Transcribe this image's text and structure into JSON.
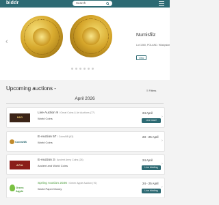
{
  "header": {
    "logo": "biddr",
    "search_placeholder": "Search"
  },
  "hero": {
    "title": "Numisfilz",
    "description": "Lot 1060, POLAND. Wladysław IV Vasa, 1632-1648. Ducat / Dukaten, Gdańsk / Danzig",
    "view_label": "View"
  },
  "section": {
    "title": "Upcoming auctions -",
    "filters_label": "Filters",
    "month": "April 2026"
  },
  "auctions": [
    {
      "name": "Live Auction 9",
      "house": "/  Great Coins & Art Auctions (77)",
      "category": "World Coins",
      "date": "24 April",
      "button": "Live now!",
      "logo_text": "MDG"
    },
    {
      "name": "E-Auction 57",
      "house": "/  CoinsNB (63)",
      "category": "World Coins",
      "date": "23 - 25 April",
      "button": "",
      "logo_text": "CoinsNB"
    },
    {
      "name": "E-Auction 3",
      "house": "/  Ancient Army Coins (28)",
      "category": "Ancient and World Coins",
      "date": "24 April",
      "button": "Live bidding",
      "logo_text": "ARA"
    },
    {
      "name": "Spring Auction 2026",
      "house": "/  Green Apple Auction (70)",
      "category": "World Paper Money",
      "date": "24 - 25 April",
      "button": "Live bidding",
      "logo_text": "Green Apple"
    }
  ]
}
